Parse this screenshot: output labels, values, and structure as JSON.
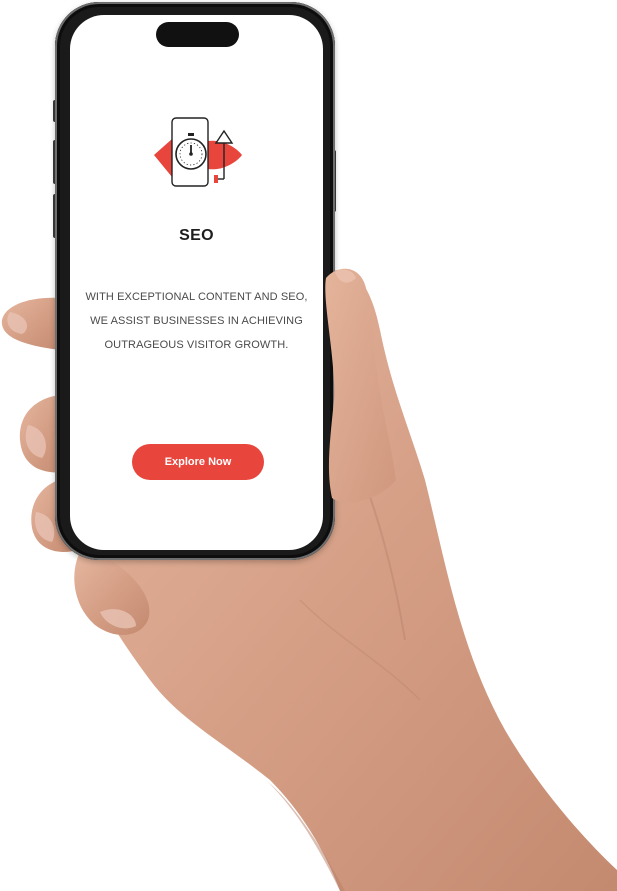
{
  "screen": {
    "title": "SEO",
    "description_lines": [
      "WITH EXCEPTIONAL CONTENT AND SEO,",
      "WE ASSIST BUSINESSES IN ACHIEVING",
      "OUTRAGEOUS VISITOR GROWTH."
    ],
    "cta_label": "Explore Now",
    "illustration_icon": "seo-stopwatch-growth-icon"
  },
  "colors": {
    "accent": "#e8453c",
    "title_text": "#1e1e1e",
    "body_text": "#4a4a4a",
    "skin": "#d9a58c"
  }
}
